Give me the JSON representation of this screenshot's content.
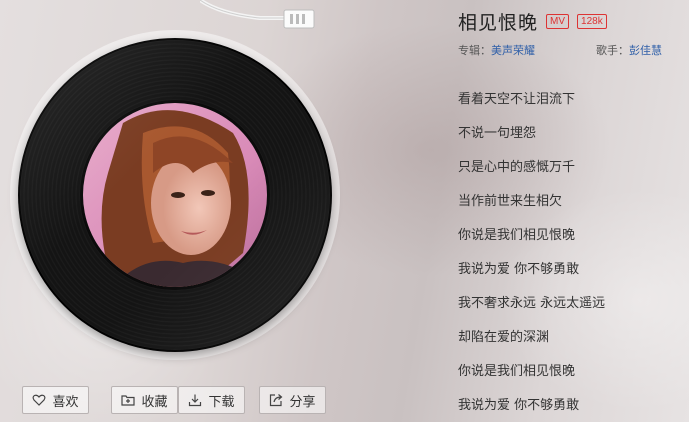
{
  "song": {
    "title": "相见恨晚",
    "tags": [
      "MV",
      "128k"
    ],
    "album_label": "专辑：",
    "album": "美声荣耀",
    "artist_label": "歌手：",
    "artist": "彭佳慧"
  },
  "lyrics": [
    "看着天空不让泪流下",
    "不说一句埋怨",
    "只是心中的感慨万千",
    "当作前世来生相欠",
    "你说是我们相见恨晚",
    "我说为爱 你不够勇敢",
    "我不奢求永远 永远太遥远",
    "却陷在爱的深渊",
    "你说是我们相见恨晚",
    "我说为爱 你不够勇敢"
  ],
  "actions": {
    "like": "喜欢",
    "collect": "收藏",
    "download": "下载",
    "share": "分享"
  },
  "colors": {
    "tag": "#dd3333",
    "link": "#2f5fa8",
    "disc": "#141414"
  },
  "icons": {
    "like": "heart-icon",
    "collect": "folder-plus-icon",
    "download": "download-icon",
    "share": "share-icon"
  }
}
